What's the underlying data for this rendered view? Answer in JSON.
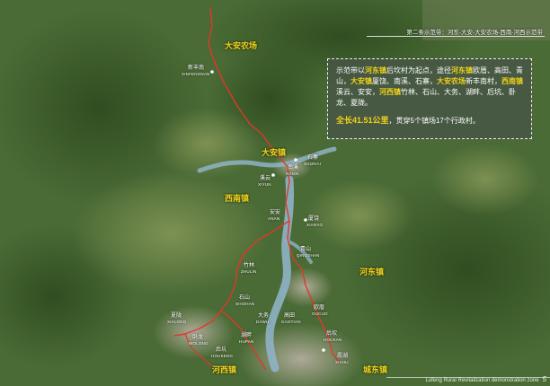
{
  "header": {
    "title": "第二条示范带：河东-大安-大安农场-西南-河西示范带"
  },
  "info": {
    "p1": [
      {
        "t": "示范带以",
        "h": false
      },
      {
        "t": "河东镇",
        "h": true
      },
      {
        "t": "后坎村为起点，途径",
        "h": false
      },
      {
        "t": "河东镇",
        "h": true
      },
      {
        "t": "欧厝、高田、青山，",
        "h": false
      },
      {
        "t": "大安镇",
        "h": true
      },
      {
        "t": "厦饶、南溪、石寨，",
        "h": false
      },
      {
        "t": "大安农场",
        "h": true
      },
      {
        "t": "新丰南村，",
        "h": false
      },
      {
        "t": "西南镇",
        "h": true
      },
      {
        "t": "溪云、安安，",
        "h": false
      },
      {
        "t": "河西镇",
        "h": true
      },
      {
        "t": "竹林、石山、大务、湖畔、后坑、卧龙、夏陇。",
        "h": false
      }
    ],
    "length": "全长41.51公里",
    "p2_rest": "，贯穿5个镇场17个行政村。"
  },
  "towns": {
    "danong": "大安农场",
    "daan": "大安镇",
    "xinan": "西南镇",
    "hedong": "河东镇",
    "hexi": "河西镇",
    "chengdong": "城东镇"
  },
  "villages": [
    {
      "cn": "新丰南",
      "en": "XINFENGNAN"
    },
    {
      "cn": "石寨",
      "en": "SHIZHAI"
    },
    {
      "cn": "南溪",
      "en": "NANXI"
    },
    {
      "cn": "溪云",
      "en": "XIYUN"
    },
    {
      "cn": "安安",
      "en": "ANAN"
    },
    {
      "cn": "厦饶",
      "en": "XIARAO"
    },
    {
      "cn": "青山",
      "en": "QINGSHAN"
    },
    {
      "cn": "竹林",
      "en": "ZHULIN"
    },
    {
      "cn": "石山",
      "en": "SHISHAN"
    },
    {
      "cn": "大务",
      "en": "DAWU"
    },
    {
      "cn": "高田",
      "en": "GAOTIAN"
    },
    {
      "cn": "欧厝",
      "en": "OUCUO"
    },
    {
      "cn": "夏陇",
      "en": "XIALONG"
    },
    {
      "cn": "卧龙",
      "en": "WOLONG"
    },
    {
      "cn": "湖畔",
      "en": "HUPAN"
    },
    {
      "cn": "后坑",
      "en": "HOUKENG"
    },
    {
      "cn": "后坎",
      "en": "HOUKAN"
    },
    {
      "cn": "霞湖",
      "en": "XIAHU"
    }
  ],
  "footer": {
    "text": "Lufeng Rural Revitalization demonstration zone",
    "page": "5"
  },
  "colors": {
    "route": "#e0372c",
    "town_label": "#f2d31b",
    "river": "#8fb3c6"
  }
}
